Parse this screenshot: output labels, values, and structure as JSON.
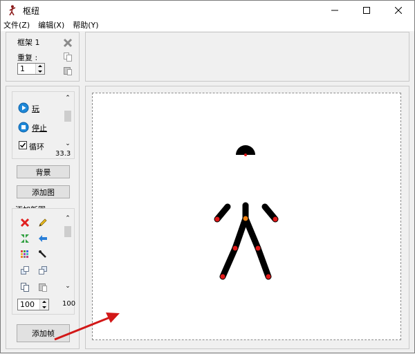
{
  "window": {
    "title": "枢纽"
  },
  "menu": [
    {
      "label": "文件(Z)"
    },
    {
      "label": "编辑(X)"
    },
    {
      "label": "帮助(Y)"
    }
  ],
  "frame_panel": {
    "title": "框架 1",
    "repeat_label": "重复 :",
    "repeat_value": "1"
  },
  "playback": {
    "play_label": "玩",
    "stop_label": "停止",
    "loop_label": "循环",
    "loop_checked": true,
    "speed_value": "33.3"
  },
  "buttons": {
    "background": "背景",
    "add_image": "添加图",
    "add_frame": "添加帧"
  },
  "new_figure": {
    "title": "添加新图",
    "size_value": "100",
    "scroll_value": "100"
  },
  "colors": {
    "accent_blue": "#1e88d8",
    "joint_red": "#e01818",
    "joint_orange": "#f08010",
    "arrow_red": "#d21818"
  }
}
